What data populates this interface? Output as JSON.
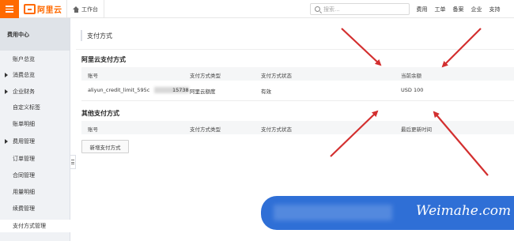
{
  "topbar": {
    "logo_text": "阿里云",
    "work_tab": "工作台",
    "search_placeholder": "搜索...",
    "nav": [
      "费用",
      "工单",
      "备案",
      "企业",
      "支持"
    ]
  },
  "sidebar": {
    "header": "费用中心",
    "items": [
      {
        "label": "账户总览",
        "caret": false,
        "active": false
      },
      {
        "label": "消费总览",
        "caret": true,
        "active": false
      },
      {
        "label": "企业财务",
        "caret": true,
        "active": false
      },
      {
        "label": "自定义标签",
        "caret": false,
        "active": false
      },
      {
        "label": "账单明细",
        "caret": false,
        "active": false
      },
      {
        "label": "费用管理",
        "caret": true,
        "active": false
      },
      {
        "label": "订单管理",
        "caret": false,
        "active": false
      },
      {
        "label": "合同管理",
        "caret": false,
        "active": false
      },
      {
        "label": "用量明细",
        "caret": false,
        "active": false
      },
      {
        "label": "续费管理",
        "caret": false,
        "active": false
      },
      {
        "label": "支付方式管理",
        "caret": false,
        "active": true
      }
    ]
  },
  "main": {
    "page_title": "支付方式",
    "aliyun_section": {
      "title": "阿里云支付方式",
      "columns": [
        "账号",
        "支付方式类型",
        "支付方式状态",
        "当前余额"
      ],
      "rows": [
        {
          "account_prefix": "aliyun_credit_limit_595c",
          "account_suffix": "15738",
          "type": "阿里云额度",
          "status": "有效",
          "balance": "USD 100"
        }
      ]
    },
    "other_section": {
      "title": "其他支付方式",
      "columns": [
        "账号",
        "支付方式类型",
        "支付方式状态",
        "最后更新时间"
      ],
      "add_button": "新增支付方式"
    }
  },
  "watermark": {
    "text": "Weimahe.com"
  },
  "colors": {
    "brand": "#ff6a00",
    "arrow": "#d32f2f",
    "watermark_bg": "#2f6fd6"
  }
}
